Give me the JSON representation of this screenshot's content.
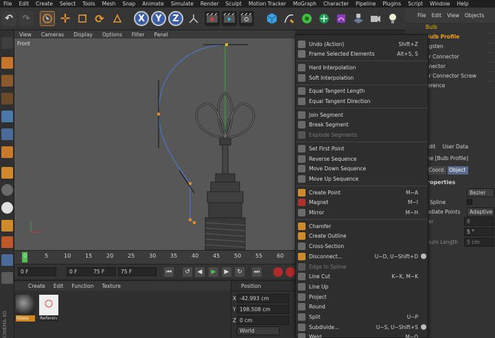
{
  "menubar": [
    "File",
    "Edit",
    "Create",
    "Select",
    "Tools",
    "Mesh",
    "Snap",
    "Animate",
    "Simulate",
    "Render",
    "Sculpt",
    "Motion Tracker",
    "MoGraph",
    "Character",
    "Pipeline",
    "Plugins",
    "Script",
    "Window",
    "Help"
  ],
  "toolbar": {
    "axis_x": "X",
    "axis_y": "Y",
    "axis_z": "Z"
  },
  "viewport_menu": [
    "View",
    "Cameras",
    "Display",
    "Options",
    "Filter",
    "Panel"
  ],
  "viewport_label": "Front",
  "timeline": {
    "ticks": [
      "0",
      "5",
      "10",
      "15",
      "20",
      "25",
      "30",
      "35",
      "40",
      "45",
      "50",
      "55",
      "60"
    ],
    "current": "0"
  },
  "transport": {
    "start": "0 F",
    "current": "0 F",
    "end_inner": "75 F",
    "end": "75 F"
  },
  "material_menu": [
    "Create",
    "Edit",
    "Function",
    "Texture"
  ],
  "materials": [
    {
      "label": "Glass",
      "ball_color": "#3a3a3a",
      "label_bg": "#d0871f"
    },
    {
      "label": "Referen",
      "ball_color": "#efefef",
      "label_bg": "#262626"
    }
  ],
  "brand": "CINEMA 4D",
  "position": {
    "title": "Position",
    "x_label": "X",
    "x_value": "-42.993 cm",
    "y_label": "Y",
    "y_value": "198.508 cm",
    "z_label": "Z",
    "z_value": "0 cm",
    "space": "World"
  },
  "object_menu": [
    "File",
    "Edit",
    "View",
    "Objects"
  ],
  "objects": [
    {
      "name": "Bulb",
      "color": "#e6b800"
    },
    {
      "name": "Bulb Profile",
      "color": "#f0a020"
    },
    {
      "name": "ngsten",
      "color": "#cfcfcf"
    },
    {
      "name": "er Connector",
      "color": "#cfcfcf"
    },
    {
      "name": "nnector",
      "color": "#cfcfcf"
    },
    {
      "name": "er Connector Screw",
      "color": "#cfcfcf"
    },
    {
      "name": "ference",
      "color": "#cfcfcf"
    }
  ],
  "attr_menu": [
    "Edit",
    "User Data"
  ],
  "attributes": {
    "object_title": "ne [Bulb Profile]",
    "tab_coord": "Coord.",
    "tab_object": "Object",
    "section": "roperties",
    "type_value": "Bezier",
    "spline_label": "Spline",
    "intermediate_label": "ediate Points",
    "intermediate_value": "Adaptive",
    "row_er": "er",
    "row_er_value": "8",
    "angle_value": "5 °",
    "length_label": "num Length",
    "length_value": "5 cm"
  },
  "context_menu": [
    {
      "label": "Undo (Action)",
      "shortcut": "Shift+Z",
      "icon": "undo-icon",
      "color": "#707070"
    },
    {
      "label": "Frame Selected Elements",
      "shortcut": "Alt+S, S",
      "icon": "frame-icon",
      "color": "#707070"
    },
    {
      "sep": true
    },
    {
      "label": "Hard Interpolation",
      "shortcut": "",
      "icon": "hard-interp-icon",
      "color": "#6a6a6a"
    },
    {
      "label": "Soft Interpolation",
      "shortcut": "",
      "icon": "soft-interp-icon",
      "color": "#6a6a6a"
    },
    {
      "sep": true
    },
    {
      "label": "Equal Tangent Length",
      "shortcut": "",
      "icon": "tangent-length-icon",
      "color": "#6a6a6a"
    },
    {
      "label": "Equal Tangent Direction",
      "shortcut": "",
      "icon": "tangent-direction-icon",
      "color": "#6a6a6a"
    },
    {
      "sep": true
    },
    {
      "label": "Join Segment",
      "shortcut": "",
      "icon": "join-segment-icon",
      "color": "#6a6a6a"
    },
    {
      "label": "Break Segment",
      "shortcut": "",
      "icon": "break-segment-icon",
      "color": "#6a6a6a"
    },
    {
      "label": "Explode Segments",
      "shortcut": "",
      "icon": "explode-icon",
      "color": "#555555",
      "disabled": true
    },
    {
      "sep": true
    },
    {
      "label": "Set First Point",
      "shortcut": "",
      "icon": "first-point-icon",
      "color": "#6a6a6a"
    },
    {
      "label": "Reverse Sequence",
      "shortcut": "",
      "icon": "reverse-icon",
      "color": "#6a6a6a"
    },
    {
      "label": "Move Down Sequence",
      "shortcut": "",
      "icon": "move-down-icon",
      "color": "#6a6a6a"
    },
    {
      "label": "Move Up Sequence",
      "shortcut": "",
      "icon": "move-up-icon",
      "color": "#6a6a6a"
    },
    {
      "sep": true
    },
    {
      "label": "Create Point",
      "shortcut": "M~A",
      "icon": "create-point-icon",
      "color": "#d08a2a"
    },
    {
      "label": "Magnet",
      "shortcut": "M~I",
      "icon": "magnet-icon",
      "color": "#b03030"
    },
    {
      "label": "Mirror",
      "shortcut": "M~H",
      "icon": "mirror-icon",
      "color": "#6a6a6a"
    },
    {
      "sep": true
    },
    {
      "label": "Chamfer",
      "shortcut": "",
      "icon": "chamfer-icon",
      "color": "#d08a2a"
    },
    {
      "label": "Create Outline",
      "shortcut": "",
      "icon": "outline-icon",
      "color": "#d08a2a"
    },
    {
      "label": "Cross-Section",
      "shortcut": "",
      "icon": "cross-section-icon",
      "color": "#6a6a6a"
    },
    {
      "label": "Disconnect...",
      "shortcut": "U~D, U~Shift+D",
      "icon": "disconnect-icon",
      "color": "#d08a2a",
      "gear": true
    },
    {
      "label": "Edge to Spline",
      "shortcut": "",
      "icon": "edge-spline-icon",
      "color": "#555555",
      "disabled": true
    },
    {
      "label": "Line Cut",
      "shortcut": "K~K, M~K",
      "icon": "line-cut-icon",
      "color": "#6a6a6a"
    },
    {
      "label": "Line Up",
      "shortcut": "",
      "icon": "line-up-icon",
      "color": "#6a6a6a"
    },
    {
      "label": "Project",
      "shortcut": "",
      "icon": "project-icon",
      "color": "#6a6a6a"
    },
    {
      "label": "Round",
      "shortcut": "",
      "icon": "round-icon",
      "color": "#6a6a6a"
    },
    {
      "label": "Split",
      "shortcut": "U~P",
      "icon": "split-icon",
      "color": "#6a6a6a"
    },
    {
      "label": "Subdivide...",
      "shortcut": "U~S, U~Shift+S",
      "icon": "subdivide-icon",
      "color": "#6a6a6a",
      "gear": true
    },
    {
      "label": "Weld",
      "shortcut": "M~Q",
      "icon": "weld-icon",
      "color": "#6a6a6a"
    }
  ]
}
